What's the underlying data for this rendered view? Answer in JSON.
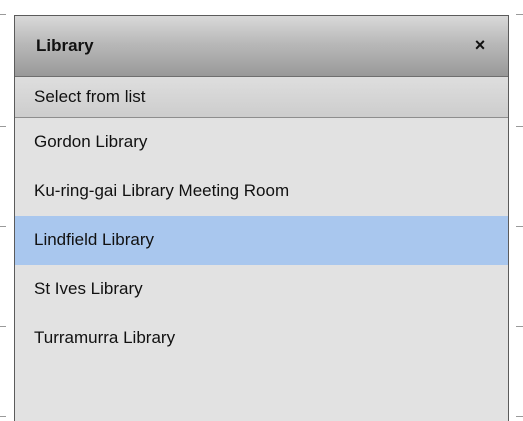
{
  "dialog": {
    "title": "Library",
    "close_label": "×"
  },
  "list": {
    "header_label": "Select from list",
    "items": [
      {
        "label": "Gordon Library",
        "selected": false
      },
      {
        "label": "Ku-ring-gai Library Meeting Room",
        "selected": false
      },
      {
        "label": "Lindfield Library",
        "selected": true
      },
      {
        "label": "St Ives Library",
        "selected": false
      },
      {
        "label": "Turramurra Library",
        "selected": false
      }
    ]
  },
  "colors": {
    "selected_row": "#a9c7ee",
    "panel_background": "#e2e2e2",
    "title_gradient_top": "#d9d9d9",
    "title_gradient_bottom": "#999999"
  }
}
